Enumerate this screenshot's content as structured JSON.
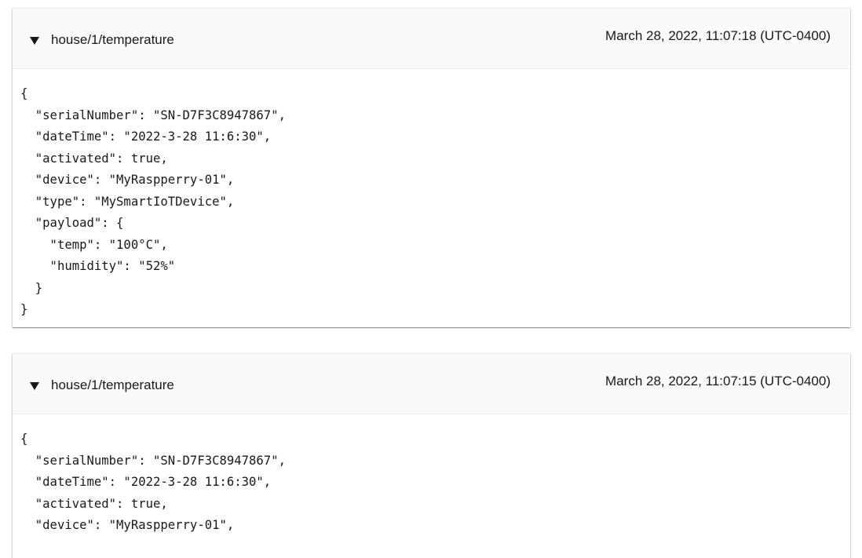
{
  "messages": [
    {
      "topic": "house/1/temperature",
      "timestamp": "March 28, 2022, 11:07:18 (UTC-0400)",
      "payload": "{\n  \"serialNumber\": \"SN-D7F3C8947867\",\n  \"dateTime\": \"2022-3-28 11:6:30\",\n  \"activated\": true,\n  \"device\": \"MyRaspperry-01\",\n  \"type\": \"MySmartIoTDevice\",\n  \"payload\": {\n    \"temp\": \"100°C\",\n    \"humidity\": \"52%\"\n  }\n}"
    },
    {
      "topic": "house/1/temperature",
      "timestamp": "March 28, 2022, 11:07:15 (UTC-0400)",
      "payload": "{\n  \"serialNumber\": \"SN-D7F3C8947867\",\n  \"dateTime\": \"2022-3-28 11:6:30\",\n  \"activated\": true,\n  \"device\": \"MyRaspperry-01\","
    }
  ],
  "icons": {
    "toggle": "caret-down-icon"
  }
}
